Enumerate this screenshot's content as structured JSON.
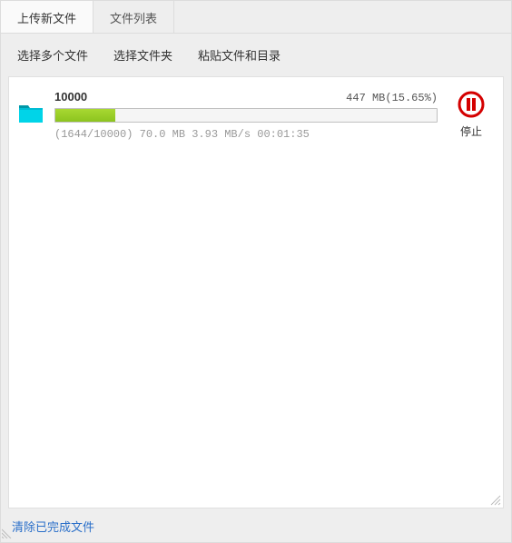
{
  "tabs": {
    "upload_new": "上传新文件",
    "file_list": "文件列表"
  },
  "toolbar": {
    "select_multiple": "选择多个文件",
    "select_folder": "选择文件夹",
    "paste_paths": "粘贴文件和目录"
  },
  "upload": {
    "name": "10000",
    "size_text": "447 MB(15.65%)",
    "stats": "(1644/10000) 70.0 MB 3.93 MB/s 00:01:35",
    "progress_percent": 15.65
  },
  "actions": {
    "pause": "停止"
  },
  "footer": {
    "clear_completed": "清除已完成文件"
  }
}
